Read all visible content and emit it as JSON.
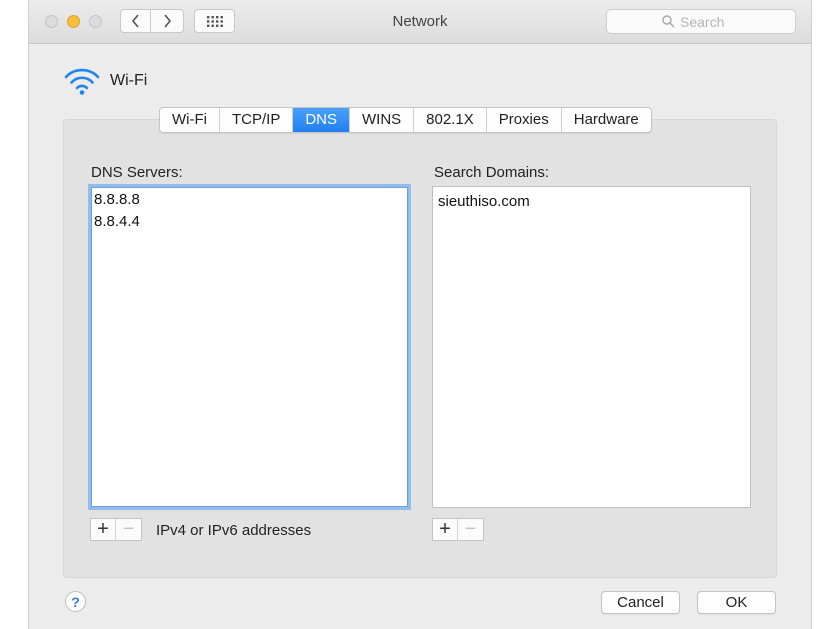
{
  "window": {
    "title": "Network"
  },
  "toolbar": {
    "search_placeholder": "Search",
    "back_icon": "chevron-left-icon",
    "forward_icon": "chevron-right-icon",
    "show_all_icon": "grid-icon"
  },
  "interface": {
    "name": "Wi-Fi",
    "icon": "wifi-icon"
  },
  "tabs": [
    {
      "label": "Wi-Fi",
      "active": false
    },
    {
      "label": "TCP/IP",
      "active": false
    },
    {
      "label": "DNS",
      "active": true
    },
    {
      "label": "WINS",
      "active": false
    },
    {
      "label": "802.1X",
      "active": false
    },
    {
      "label": "Proxies",
      "active": false
    },
    {
      "label": "Hardware",
      "active": false
    }
  ],
  "dns": {
    "label": "DNS Servers:",
    "servers": [
      "8.8.8.8",
      "8.8.4.4"
    ],
    "hint": "IPv4 or IPv6 addresses"
  },
  "search_domains": {
    "label": "Search Domains:",
    "domains": [
      "sieuthiso.com"
    ]
  },
  "buttons": {
    "add": "+",
    "remove": "−",
    "help": "?",
    "cancel": "Cancel",
    "ok": "OK"
  },
  "colors": {
    "accent": "#1f7ef1",
    "minimize": "#f5be3d",
    "focus_ring": "#92bdea"
  }
}
